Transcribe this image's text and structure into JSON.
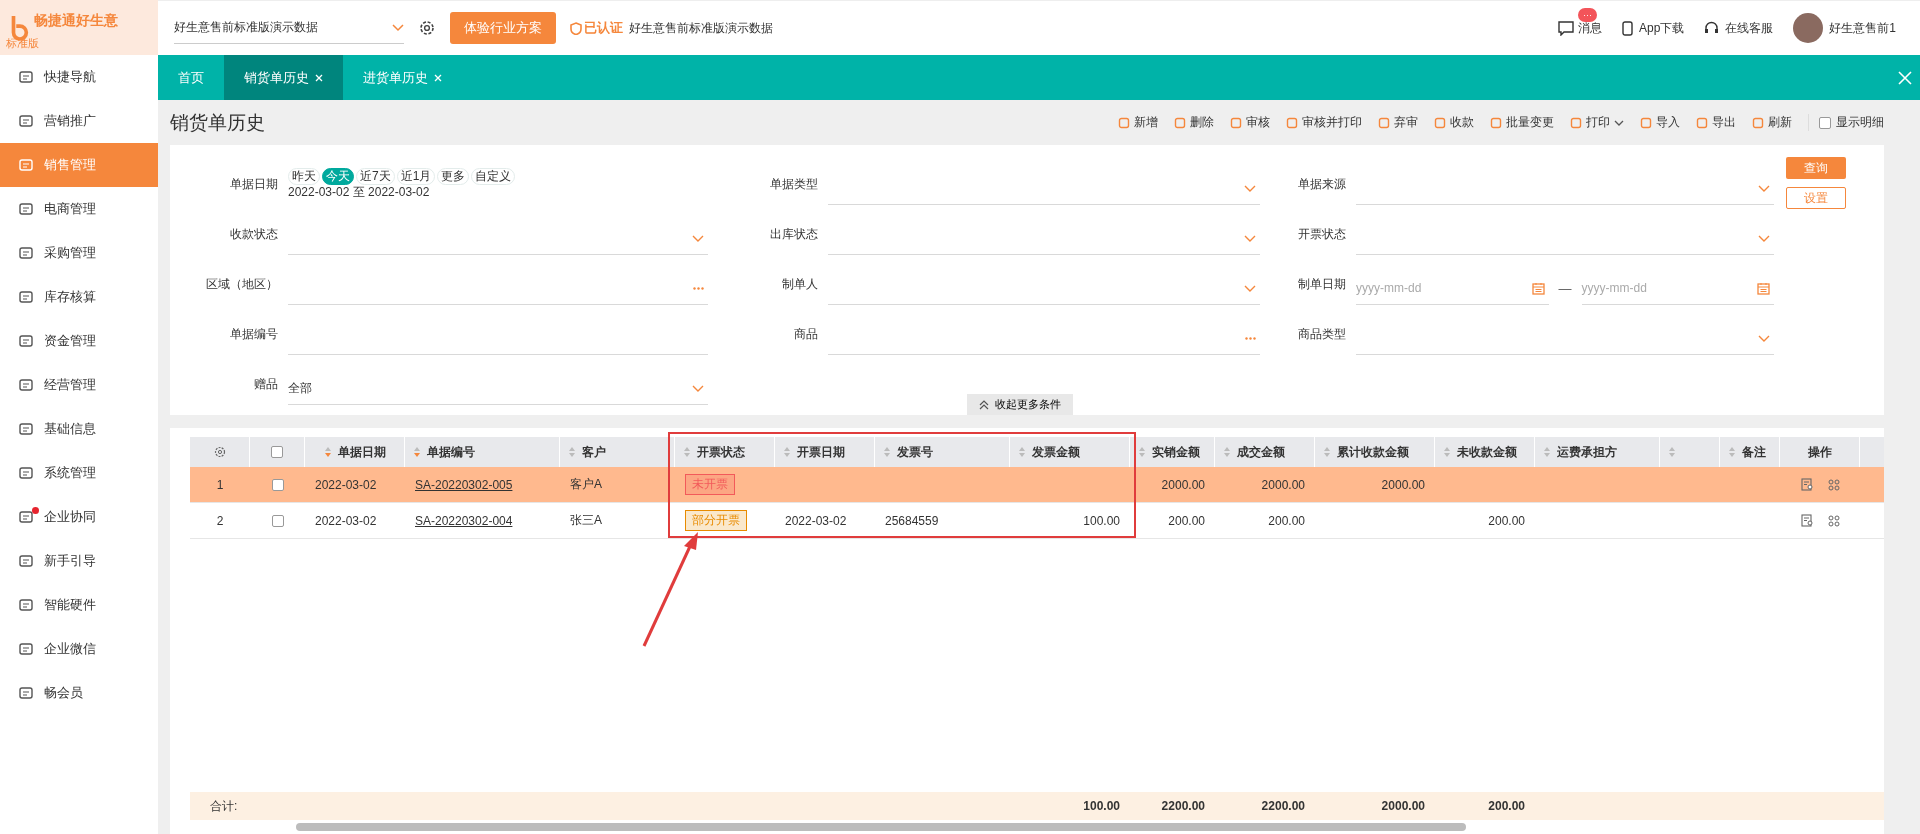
{
  "logo": {
    "name": "畅捷通好生意",
    "edition": "标准版"
  },
  "topbar": {
    "account_select": "好生意售前标准版演示数据",
    "trial_button": "体验行业方案",
    "verified": "已认证",
    "company": "好生意售前标准版演示数据",
    "message": "消息",
    "message_badge": "···",
    "app_download": "App下载",
    "support": "在线客服",
    "user": "好生意售前1"
  },
  "sidebar": {
    "items": [
      {
        "label": "快捷导航",
        "selected": false,
        "dot": false
      },
      {
        "label": "营销推广",
        "selected": false,
        "dot": false
      },
      {
        "label": "销售管理",
        "selected": true,
        "dot": false
      },
      {
        "label": "电商管理",
        "selected": false,
        "dot": false
      },
      {
        "label": "采购管理",
        "selected": false,
        "dot": false
      },
      {
        "label": "库存核算",
        "selected": false,
        "dot": false
      },
      {
        "label": "资金管理",
        "selected": false,
        "dot": false
      },
      {
        "label": "经营管理",
        "selected": false,
        "dot": false
      },
      {
        "label": "基础信息",
        "selected": false,
        "dot": false
      },
      {
        "label": "系统管理",
        "selected": false,
        "dot": false
      },
      {
        "label": "企业协同",
        "selected": false,
        "dot": true
      },
      {
        "label": "新手引导",
        "selected": false,
        "dot": false
      },
      {
        "label": "智能硬件",
        "selected": false,
        "dot": false
      },
      {
        "label": "企业微信",
        "selected": false,
        "dot": false
      },
      {
        "label": "畅会员",
        "selected": false,
        "dot": false
      }
    ]
  },
  "tabs": [
    {
      "label": "首页",
      "selected": false,
      "closable": false
    },
    {
      "label": "销货单历史",
      "selected": true,
      "closable": true
    },
    {
      "label": "进货单历史",
      "selected": false,
      "closable": true
    }
  ],
  "page_title": "销货单历史",
  "toolbar": [
    {
      "label": "新增",
      "has_menu": false
    },
    {
      "label": "删除",
      "has_menu": false
    },
    {
      "label": "审核",
      "has_menu": false
    },
    {
      "label": "审核并打印",
      "has_menu": false
    },
    {
      "label": "弃审",
      "has_menu": false
    },
    {
      "label": "收款",
      "has_menu": false
    },
    {
      "label": "批量变更",
      "has_menu": false
    },
    {
      "label": "打印",
      "has_menu": true
    },
    {
      "label": "导入",
      "has_menu": false
    },
    {
      "label": "导出",
      "has_menu": false
    },
    {
      "label": "刷新",
      "has_menu": false
    }
  ],
  "show_detail": {
    "label": "显示明细",
    "checked": false
  },
  "filters": [
    {
      "label": "单据日期",
      "kind": "date_preset",
      "presets": [
        {
          "label": "昨天",
          "selected": false
        },
        {
          "label": "今天",
          "selected": true
        },
        {
          "label": "近7天",
          "selected": false
        },
        {
          "label": "近1月",
          "selected": false
        },
        {
          "label": "更多",
          "selected": false
        },
        {
          "label": "自定义",
          "selected": false
        }
      ],
      "range": "2022-03-02 至 2022-03-02"
    },
    {
      "label": "单据类型",
      "kind": "select"
    },
    {
      "label": "单据来源",
      "kind": "select"
    },
    {
      "label": "收款状态",
      "kind": "select"
    },
    {
      "label": "出库状态",
      "kind": "select"
    },
    {
      "label": "开票状态",
      "kind": "select"
    },
    {
      "label": "区域（地区）",
      "kind": "picker"
    },
    {
      "label": "制单人",
      "kind": "select"
    },
    {
      "label": "制单日期",
      "kind": "date_range",
      "placeholder": "yyyy-mm-dd",
      "separator": "—",
      "placeholder_end": "yyyy-mm-dd"
    },
    {
      "label": "单据编号",
      "kind": "text"
    },
    {
      "label": "商品",
      "kind": "picker"
    },
    {
      "label": "商品类型",
      "kind": "select"
    },
    {
      "label": "赠品",
      "kind": "select",
      "value": "全部"
    }
  ],
  "query_button": "查询",
  "settings_button": "设置",
  "collapse": "收起更多条件",
  "table": {
    "columns": [
      {
        "label": "单据日期",
        "sorted": true
      },
      {
        "label": "单据编号",
        "sorted": true
      },
      {
        "label": "客户",
        "sorted": false
      },
      {
        "label": "开票状态",
        "sorted": false
      },
      {
        "label": "开票日期",
        "sorted": false
      },
      {
        "label": "发票号",
        "sorted": false
      },
      {
        "label": "发票金额",
        "sorted": false,
        "total": "100.00"
      },
      {
        "label": "实销金额",
        "sorted": false,
        "total": "2200.00"
      },
      {
        "label": "成交金额",
        "sorted": false,
        "total": "2200.00"
      },
      {
        "label": "累计收款金额",
        "sorted": false,
        "total": "2000.00"
      },
      {
        "label": "未收款金额",
        "sorted": false,
        "total": "200.00"
      },
      {
        "label": "运费承担方",
        "sorted": false
      },
      {
        "sorted": false
      },
      {
        "label": "备注",
        "sorted": false
      },
      {
        "label": "操作"
      }
    ],
    "all_checked": false,
    "rows": [
      {
        "index": "1",
        "checked": false,
        "selected": true,
        "cells": [
          {
            "text": "2022-03-02"
          },
          {
            "text": "SA-20220302-005",
            "link": true
          },
          {
            "text": "客户A"
          },
          {
            "text": "未开票",
            "color": "#f25a5a"
          },
          {},
          {},
          {},
          {
            "text": "2000.00"
          },
          {
            "text": "2000.00"
          },
          {
            "text": "2000.00"
          },
          {},
          {},
          {},
          {}
        ]
      },
      {
        "index": "2",
        "checked": false,
        "selected": false,
        "cells": [
          {
            "text": "2022-03-02"
          },
          {
            "text": "SA-20220302-004",
            "link": true
          },
          {
            "text": "张三A"
          },
          {
            "text": "部分开票",
            "color": "#e88b00"
          },
          {
            "text": "2022-03-02"
          },
          {
            "text": "25684559"
          },
          {
            "text": "100.00"
          },
          {
            "text": "200.00"
          },
          {
            "text": "200.00"
          },
          {},
          {
            "text": "200.00"
          },
          {},
          {},
          {}
        ]
      }
    ],
    "totals_label": "合计:"
  }
}
